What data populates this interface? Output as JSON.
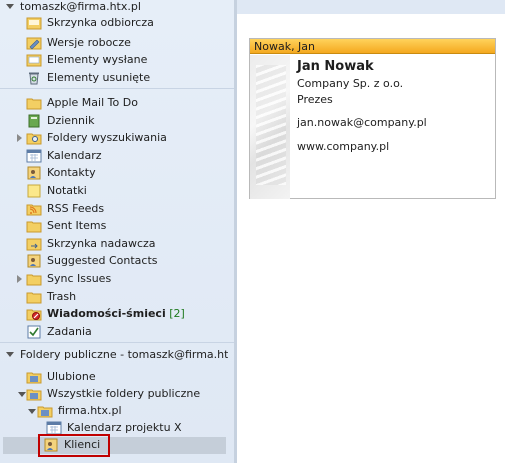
{
  "account": {
    "label": "tomaszk@firma.htx.pl"
  },
  "folders": [
    {
      "label": "Skrzynka odbiorcza",
      "icon": "inbox-icon"
    },
    {
      "label": "Wersje robocze",
      "icon": "drafts-icon"
    },
    {
      "label": "Elementy wysłane",
      "icon": "sent-items-icon"
    },
    {
      "label": "Elementy usunięte",
      "icon": "deleted-items-icon"
    },
    {
      "label": "Apple Mail To Do",
      "icon": "folder-icon"
    },
    {
      "label": "Dziennik",
      "icon": "journal-icon"
    },
    {
      "label": "Foldery wyszukiwania",
      "icon": "search-folder-icon"
    },
    {
      "label": "Kalendarz",
      "icon": "calendar-icon"
    },
    {
      "label": "Kontakty",
      "icon": "contacts-icon"
    },
    {
      "label": "Notatki",
      "icon": "notes-icon"
    },
    {
      "label": "RSS Feeds",
      "icon": "rss-icon"
    },
    {
      "label": "Sent Items",
      "icon": "folder-icon"
    },
    {
      "label": "Skrzynka nadawcza",
      "icon": "outbox-icon"
    },
    {
      "label": "Suggested Contacts",
      "icon": "contacts-icon"
    },
    {
      "label": "Sync Issues",
      "icon": "folder-icon"
    },
    {
      "label": "Trash",
      "icon": "folder-icon"
    },
    {
      "label": "Wiadomości-śmieci",
      "count": "[2]",
      "icon": "junk-icon"
    },
    {
      "label": "Zadania",
      "icon": "tasks-icon"
    }
  ],
  "public": {
    "label": "Foldery publiczne - tomaszk@firma.htx.pl",
    "items": [
      {
        "label": "Ulubione",
        "icon": "favorites-folder-icon"
      },
      {
        "label": "Wszystkie foldery publiczne",
        "icon": "public-folders-icon"
      },
      {
        "label": "firma.htx.pl",
        "icon": "public-folder-icon"
      },
      {
        "label": "Kalendarz projektu X",
        "icon": "calendar-icon"
      },
      {
        "label": "Klienci",
        "icon": "contacts-folder-icon"
      }
    ]
  },
  "contact_card": {
    "title": "Nowak, Jan",
    "name": "Jan Nowak",
    "company": "Company Sp. z o.o.",
    "position": "Prezes",
    "email": "jan.nowak@company.pl",
    "website": "www.company.pl"
  },
  "colors": {
    "nav_bg": "#e6eef8",
    "card_header": "#f4a81f",
    "selected_outline": "#c00000",
    "junk_count": "#1e7a1e"
  }
}
